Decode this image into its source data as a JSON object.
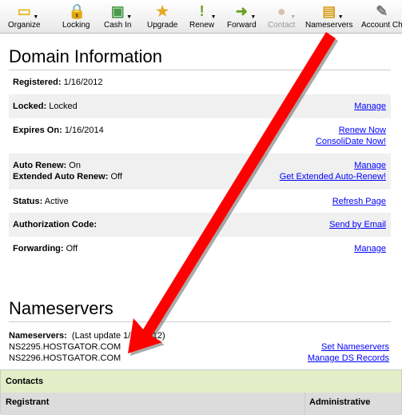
{
  "toolbar": {
    "items": [
      {
        "label": "Organize",
        "icon": "folder-icon",
        "dropdown": true,
        "disabled": false
      },
      {
        "label": "Locking",
        "icon": "lock-icon",
        "dropdown": false,
        "disabled": false
      },
      {
        "label": "Cash In",
        "icon": "cash-in-icon",
        "dropdown": true,
        "disabled": false
      },
      {
        "label": "Upgrade",
        "icon": "star-medal-icon",
        "dropdown": false,
        "disabled": false
      },
      {
        "label": "Renew",
        "icon": "exclamation-icon",
        "dropdown": true,
        "disabled": false
      },
      {
        "label": "Forward",
        "icon": "forward-arrow-icon",
        "dropdown": true,
        "disabled": false
      },
      {
        "label": "Contact",
        "icon": "contact-person-icon",
        "dropdown": true,
        "disabled": true
      },
      {
        "label": "Nameservers",
        "icon": "database-icon",
        "dropdown": true,
        "disabled": false
      },
      {
        "label": "Account Ch",
        "icon": "account-edit-icon",
        "dropdown": false,
        "disabled": false
      }
    ]
  },
  "domain_info": {
    "title": "Domain Information",
    "registered": {
      "label": "Registered:",
      "value": "1/16/2012"
    },
    "locked": {
      "label": "Locked:",
      "value": "Locked",
      "link": "Manage"
    },
    "expires": {
      "label": "Expires On:",
      "value": "1/16/2014",
      "link1": "Renew Now",
      "link2": "ConsoliDate Now!"
    },
    "auto_renew": {
      "label": "Auto Renew:",
      "value": "On",
      "link": "Manage"
    },
    "ext_auto_renew": {
      "label": "Extended Auto Renew:",
      "value": "Off",
      "link": "Get Extended Auto-Renew!"
    },
    "status": {
      "label": "Status:",
      "value": "Active",
      "link": "Refresh Page"
    },
    "auth": {
      "label": "Authorization Code:",
      "link": "Send by Email"
    },
    "forwarding": {
      "label": "Forwarding:",
      "value": "Off",
      "link": "Manage"
    }
  },
  "nameservers": {
    "title": "Nameservers",
    "label": "Nameservers:",
    "last_update": "(Last update 1/16/2012)",
    "servers": [
      "NS2295.HOSTGATOR.COM",
      "NS2296.HOSTGATOR.COM"
    ],
    "link1": "Set Nameservers",
    "link2": "Manage DS Records"
  },
  "contacts": {
    "title": "Contacts",
    "columns": [
      "Registrant",
      "Administrative"
    ]
  },
  "colors": {
    "link": "#0000ff",
    "arrow": "#ff0000",
    "contacts_header": "#e3eec8",
    "row_alt": "#f0f0f0"
  }
}
